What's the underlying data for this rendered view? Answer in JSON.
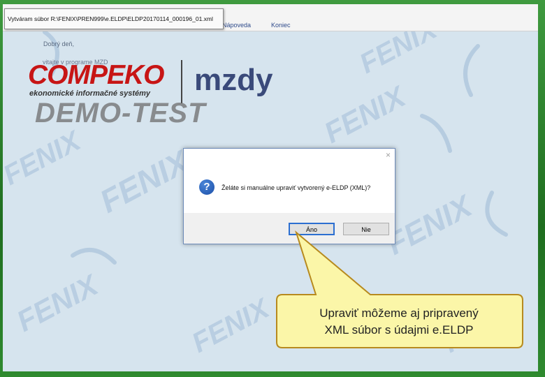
{
  "window": {
    "title": "Vytváram súbor R:\\FENIX\\PREN999\\e.ELDP\\ELDP20170114_000196_01.xml"
  },
  "menu": {
    "items": [
      "Nápoveda",
      "Koniec"
    ]
  },
  "home": {
    "greeting": "Dobrý deň,",
    "welcome": "vitajte v programe MZD",
    "brand": "COMPEKO",
    "brand_sub": "ekonomické informačné systémy",
    "product": "mzdy",
    "demo": "DEMO-TEST",
    "watermark_text": "FENIX"
  },
  "dialog": {
    "close_icon": "close-icon",
    "question_icon": "question-icon",
    "question_glyph": "?",
    "close_glyph": "×",
    "message": "Želáte si manuálne upraviť vytvorený e-ELDP (XML)?",
    "yes_label": "Áno",
    "no_label": "Nie"
  },
  "callout": {
    "line1": "Upraviť môžeme aj pripravený",
    "line2": "XML súbor s údajmi e.ELDP"
  },
  "colors": {
    "slide_border": "#2f7d2f",
    "app_background": "#d6e4ee",
    "brand_red": "#c71515",
    "product_blue": "#3a4a7a",
    "callout_fill": "#fbf6a8",
    "callout_border": "#b78a1e",
    "dialog_focus": "#2c6fd1"
  }
}
